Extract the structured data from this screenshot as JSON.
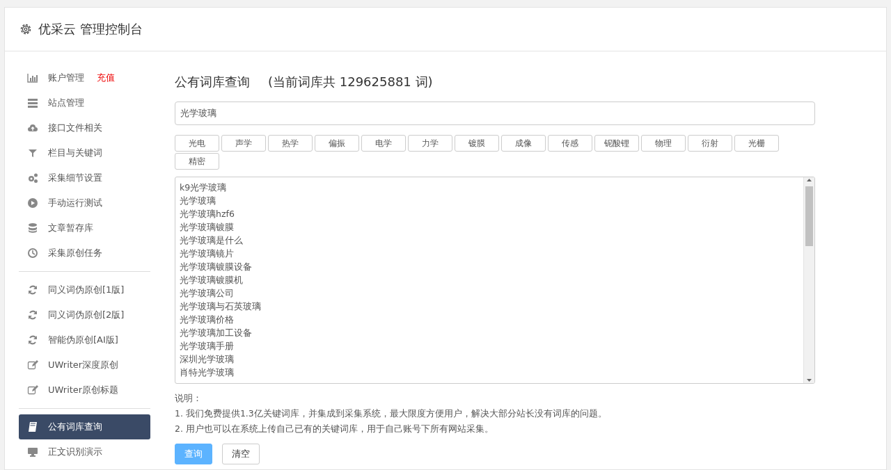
{
  "header": {
    "title": "优采云 管理控制台"
  },
  "sidebar": {
    "groups": [
      {
        "items": [
          {
            "label": "账户管理",
            "link": "充值",
            "selected": false
          },
          {
            "label": "站点管理",
            "selected": false
          },
          {
            "label": "接口文件相关",
            "selected": false
          },
          {
            "label": "栏目与关键词",
            "selected": false
          },
          {
            "label": "采集细节设置",
            "selected": false
          },
          {
            "label": "手动运行测试",
            "selected": false
          },
          {
            "label": "文章暂存库",
            "selected": false
          },
          {
            "label": "采集原创任务",
            "selected": false
          }
        ]
      },
      {
        "items": [
          {
            "label": "同义词伪原创[1版]",
            "selected": false
          },
          {
            "label": "同义词伪原创[2版]",
            "selected": false
          },
          {
            "label": "智能伪原创[AI版]",
            "selected": false
          },
          {
            "label": "UWriter深度原创",
            "selected": false
          },
          {
            "label": "UWriter原创标题",
            "selected": false
          }
        ]
      },
      {
        "items": [
          {
            "label": "公有词库查询",
            "selected": true
          },
          {
            "label": "正文识别演示",
            "selected": false
          }
        ]
      }
    ]
  },
  "main": {
    "title": "公有词库查询",
    "count_note": "(当前词库共 129625881 词)",
    "search": {
      "value": "光学玻璃"
    },
    "tags": [
      "光电",
      "声学",
      "热学",
      "偏振",
      "电学",
      "力学",
      "镀膜",
      "成像",
      "传感",
      "铌酸锂",
      "物理",
      "衍射",
      "光栅",
      "精密"
    ],
    "results": [
      "k9光学玻璃",
      "光学玻璃",
      "光学玻璃hzf6",
      "光学玻璃镀膜",
      "光学玻璃是什么",
      "光学玻璃镜片",
      "光学玻璃镀膜设备",
      "光学玻璃镀膜机",
      "光学玻璃公司",
      "光学玻璃与石英玻璃",
      "光学玻璃价格",
      "光学玻璃加工设备",
      "光学玻璃手册",
      "深圳光学玻璃",
      "肖特光学玻璃"
    ],
    "notes_title": "说明：",
    "notes": [
      "1. 我们免费提供1.3亿关键词库，并集成到采集系统，最大限度方便用户，解决大部分站长没有词库的问题。",
      "2. 用户也可以在系统上传自己已有的关键词库，用于自己账号下所有网站采集。"
    ],
    "buttons": [
      {
        "label": "查询",
        "kind": "primary"
      },
      {
        "label": "清空",
        "kind": "default"
      }
    ]
  }
}
